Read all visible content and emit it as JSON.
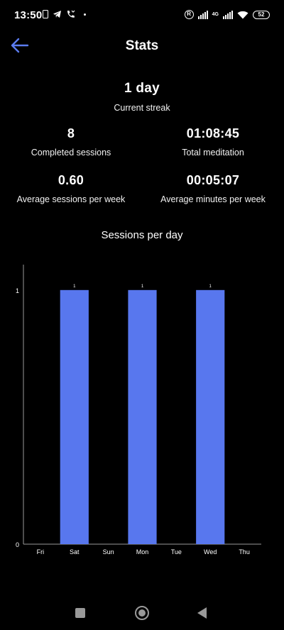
{
  "status_bar": {
    "time": "13:50",
    "network_label": "4G",
    "battery": "52"
  },
  "header": {
    "title": "Stats",
    "back_icon": "arrow-left-icon",
    "accent_color": "#5b7cf0"
  },
  "stats": {
    "streak": {
      "value": "1 day",
      "label": "Current streak"
    },
    "completed_sessions": {
      "value": "8",
      "label": "Completed sessions"
    },
    "total_meditation": {
      "value": "01:08:45",
      "label": "Total meditation"
    },
    "avg_sessions_week": {
      "value": "0.60",
      "label": "Average sessions per week"
    },
    "avg_minutes_week": {
      "value": "00:05:07",
      "label": "Average minutes per week"
    }
  },
  "chart_title": "Sessions per day",
  "chart_data": {
    "type": "bar",
    "title": "Sessions per day",
    "categories": [
      "Fri",
      "Sat",
      "Sun",
      "Mon",
      "Tue",
      "Wed",
      "Thu"
    ],
    "values": [
      0,
      1,
      0,
      1,
      0,
      1,
      0
    ],
    "data_labels": [
      "",
      "1",
      "",
      "1",
      "",
      "1",
      ""
    ],
    "y_ticks": [
      "0",
      "1"
    ],
    "ylim": [
      0,
      1.1
    ],
    "bar_color": "#5877ee",
    "grid": false
  }
}
